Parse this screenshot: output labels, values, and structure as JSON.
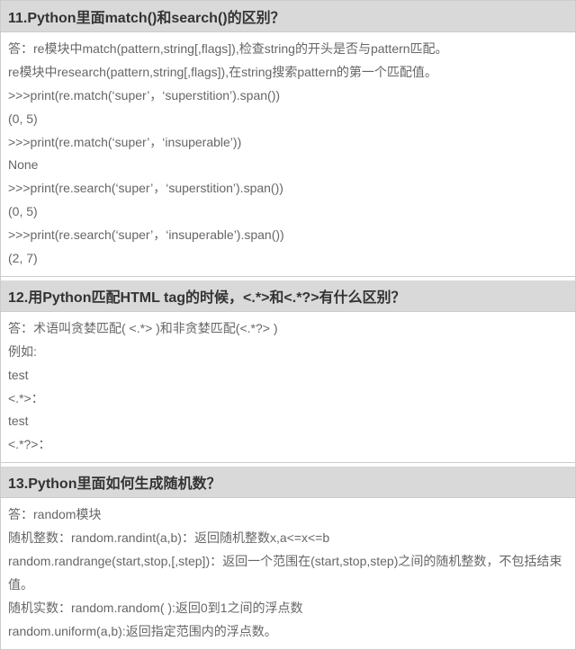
{
  "sections": [
    {
      "heading": "11.Python里面match()和search()的区别？",
      "lines": [
        "答：re模块中match(pattern,string[,flags]),检查string的开头是否与pattern匹配。",
        "re模块中research(pattern,string[,flags]),在string搜索pattern的第一个匹配值。",
        ">>>print(re.match(‘super’，‘superstition’).span())",
        "(0, 5)",
        ">>>print(re.match(‘super’，‘insuperable’))",
        "None",
        ">>>print(re.search(‘super’，‘superstition’).span())",
        "(0, 5)",
        ">>>print(re.search(‘super’，‘insuperable’).span())",
        "(2, 7)"
      ]
    },
    {
      "heading": "12.用Python匹配HTML tag的时候，<.*>和<.*?>有什么区别？",
      "lines": [
        "答：术语叫贪婪匹配( <.*> )和非贪婪匹配(<.*?> )",
        "例如:",
        "test",
        "<.*>：",
        "test",
        "<.*?>："
      ]
    },
    {
      "heading": "13.Python里面如何生成随机数？",
      "lines": [
        "答：random模块",
        "随机整数：random.randint(a,b)：返回随机整数x,a<=x<=b",
        "random.randrange(start,stop,[,step])：返回一个范围在(start,stop,step)之间的随机整数，不包括结束值。",
        "随机实数：random.random( ):返回0到1之间的浮点数",
        "random.uniform(a,b):返回指定范围内的浮点数。"
      ]
    }
  ]
}
